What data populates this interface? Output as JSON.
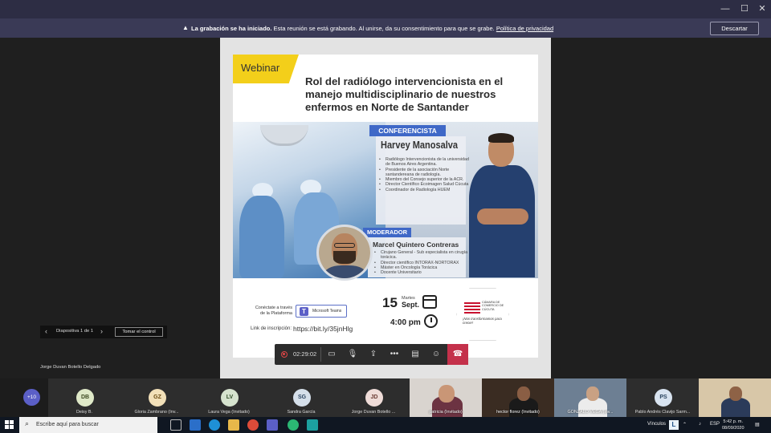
{
  "window": {
    "controls": [
      "—",
      "☐",
      "✕"
    ]
  },
  "recording_banner": {
    "bold_text": "La grabación se ha iniciado.",
    "text": "Esta reunión se está grabando. Al unirse, da su consentimiento para que se grabe.",
    "link": "Política de privacidad",
    "dismiss_label": "Descartar"
  },
  "slide": {
    "tag": "Webinar",
    "title": "Rol del radiólogo intervencionista en el manejo multidisciplinario de nuestros enfermos en Norte de Santander",
    "speaker_band": "CONFERENCISTA",
    "speaker_name": "Harvey Manosalva",
    "speaker_bullets": [
      "Radiólogo Intervencionista de la universidad de Buenos Aires Argentina.",
      "Presidente de la asociación Norte santandereana de radiología.",
      "Miembro del Consejo superior de la ACR.",
      "Director Científico Ecoimagen Salud Cúcuta",
      "Coordinador de Radiología HUEM"
    ],
    "moderator_band": "MODERADOR",
    "moderator_name": "Marcel Quintero Contreras",
    "moderator_bullets": [
      "Cirujano General - Sub especialista en cirugía torácica.",
      "Director científico INTORAX-NORTORAX",
      "Máster en Oncología Torácica",
      "Docente Universitario"
    ],
    "connect_line1": "Conéctate a través",
    "connect_line2": "de la Plataforma",
    "platform": "Microsoft Teams",
    "url_label": "Link de inscripción:",
    "url": "https://bit.ly/35jnHlg",
    "date_day": "15",
    "date_weekday": "Martes",
    "date_month": "Sept.",
    "time": "4:00 pm",
    "org_name": "CÁMARA DE COMERCIO DE CÚCUTA",
    "org_slogan": "¡Nos transformamos para crecer!"
  },
  "controls": {
    "timer": "02:29:02",
    "camera_icon": "camera-icon",
    "mic_icon": "mic-icon",
    "share_icon": "share-icon",
    "more_icon": "more-icon",
    "chat_icon": "chat-icon",
    "participants_icon": "participants-icon",
    "hangup_icon": "hangup-icon"
  },
  "presenter": {
    "slide_label": "Diapositiva 1 de 1",
    "take_control": "Tomar el control",
    "name": "Jorge Duvan Botello Delgado"
  },
  "participants": {
    "more": "+10",
    "tiles": [
      {
        "initials": "DB",
        "name": "Deisy B.",
        "color": "#dfe9c8"
      },
      {
        "initials": "GZ",
        "name": "Gloria Zambrano (Inv...",
        "color": "#f2e0b8"
      },
      {
        "initials": "LV",
        "name": "Laura Vega (Invitado)",
        "color": "#d6e3ce"
      },
      {
        "initials": "SG",
        "name": "Sandra García",
        "color": "#d5dfea"
      },
      {
        "initials": "JD",
        "name": "Jorge Duvan Botello ...",
        "color": "#efdcd8"
      }
    ],
    "video_tiles": [
      {
        "name": "patricia (Invitado)"
      },
      {
        "name": "hector florez (Invitado)"
      },
      {
        "name": "GONZALO VEGA (Inv..."
      },
      {
        "name": "Pablo Andrés Clavijo Sarm..."
      },
      {
        "name": ""
      }
    ],
    "ps_initials": "PS"
  },
  "taskbar": {
    "search_placeholder": "Escribe aquí para buscar",
    "tray_label": "Vínculos",
    "lang": "ESP",
    "time": "5:42 p. m.",
    "date": "08/09/2020"
  }
}
